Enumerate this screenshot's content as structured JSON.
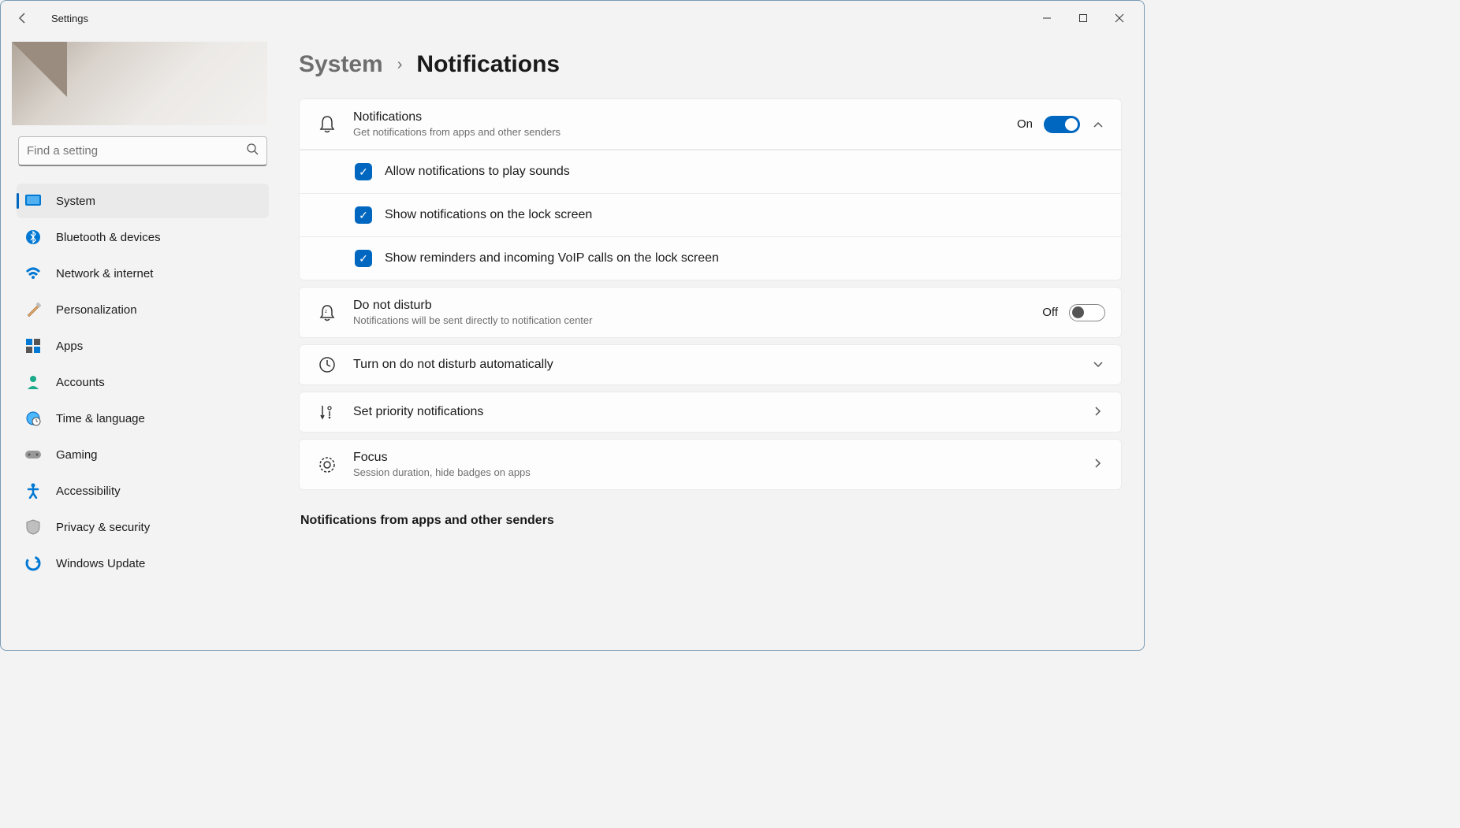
{
  "app": {
    "title": "Settings"
  },
  "search": {
    "placeholder": "Find a setting"
  },
  "sidebar": {
    "items": [
      {
        "label": "System"
      },
      {
        "label": "Bluetooth & devices"
      },
      {
        "label": "Network & internet"
      },
      {
        "label": "Personalization"
      },
      {
        "label": "Apps"
      },
      {
        "label": "Accounts"
      },
      {
        "label": "Time & language"
      },
      {
        "label": "Gaming"
      },
      {
        "label": "Accessibility"
      },
      {
        "label": "Privacy & security"
      },
      {
        "label": "Windows Update"
      }
    ]
  },
  "breadcrumb": {
    "parent": "System",
    "current": "Notifications"
  },
  "notifications": {
    "title": "Notifications",
    "subtitle": "Get notifications from apps and other senders",
    "state_label": "On",
    "checks": [
      "Allow notifications to play sounds",
      "Show notifications on the lock screen",
      "Show reminders and incoming VoIP calls on the lock screen"
    ]
  },
  "dnd": {
    "title": "Do not disturb",
    "subtitle": "Notifications will be sent directly to notification center",
    "state_label": "Off"
  },
  "dnd_auto": {
    "title": "Turn on do not disturb automatically"
  },
  "priority": {
    "title": "Set priority notifications"
  },
  "focus": {
    "title": "Focus",
    "subtitle": "Session duration, hide badges on apps"
  },
  "apps_section": {
    "title": "Notifications from apps and other senders"
  }
}
